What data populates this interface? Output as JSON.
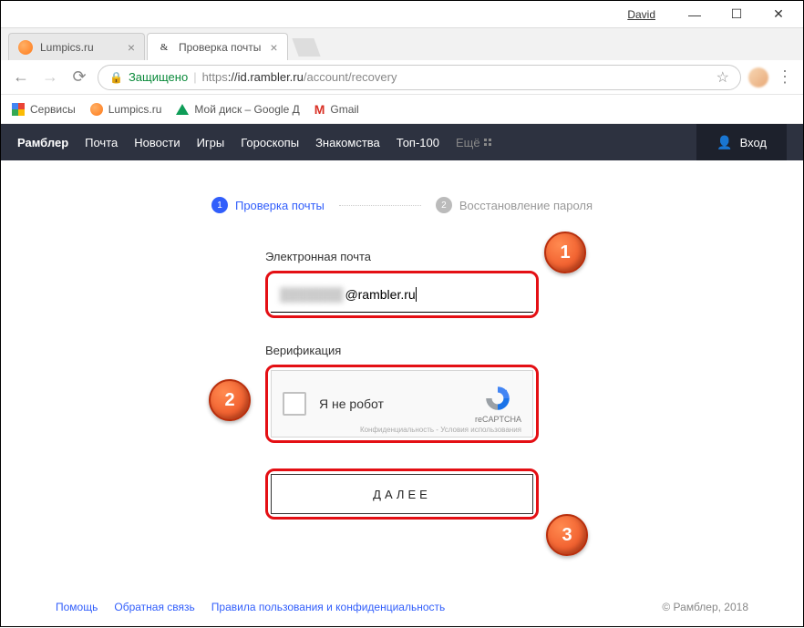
{
  "window": {
    "user": "David"
  },
  "tabs": [
    {
      "title": "Lumpics.ru"
    },
    {
      "title": "Проверка почты"
    }
  ],
  "address": {
    "secure_label": "Защищено",
    "protocol": "https",
    "host": "://id.rambler.ru",
    "path": "/account/recovery"
  },
  "bookmarks": {
    "apps": "Сервисы",
    "lumpics": "Lumpics.ru",
    "drive": "Мой диск – Google Д",
    "gmail": "Gmail"
  },
  "nav": {
    "items": [
      "Рамблер",
      "Почта",
      "Новости",
      "Игры",
      "Гороскопы",
      "Знакомства",
      "Топ-100"
    ],
    "more": "Ещё",
    "login": "Вход"
  },
  "steps": {
    "s1_num": "1",
    "s1_label": "Проверка почты",
    "s2_num": "2",
    "s2_label": "Восстановление пароля"
  },
  "form": {
    "email_label": "Электронная почта",
    "email_value": "@rambler.ru",
    "verify_label": "Верификация",
    "captcha_text": "Я не робот",
    "captcha_brand": "reCAPTCHA",
    "captcha_links": "Конфиденциальность - Условия использования",
    "next": "ДАЛЕЕ"
  },
  "callouts": {
    "c1": "1",
    "c2": "2",
    "c3": "3"
  },
  "footer": {
    "help": "Помощь",
    "feedback": "Обратная связь",
    "terms": "Правила пользования и конфиденциальность",
    "copy": "© Рамблер, 2018"
  }
}
